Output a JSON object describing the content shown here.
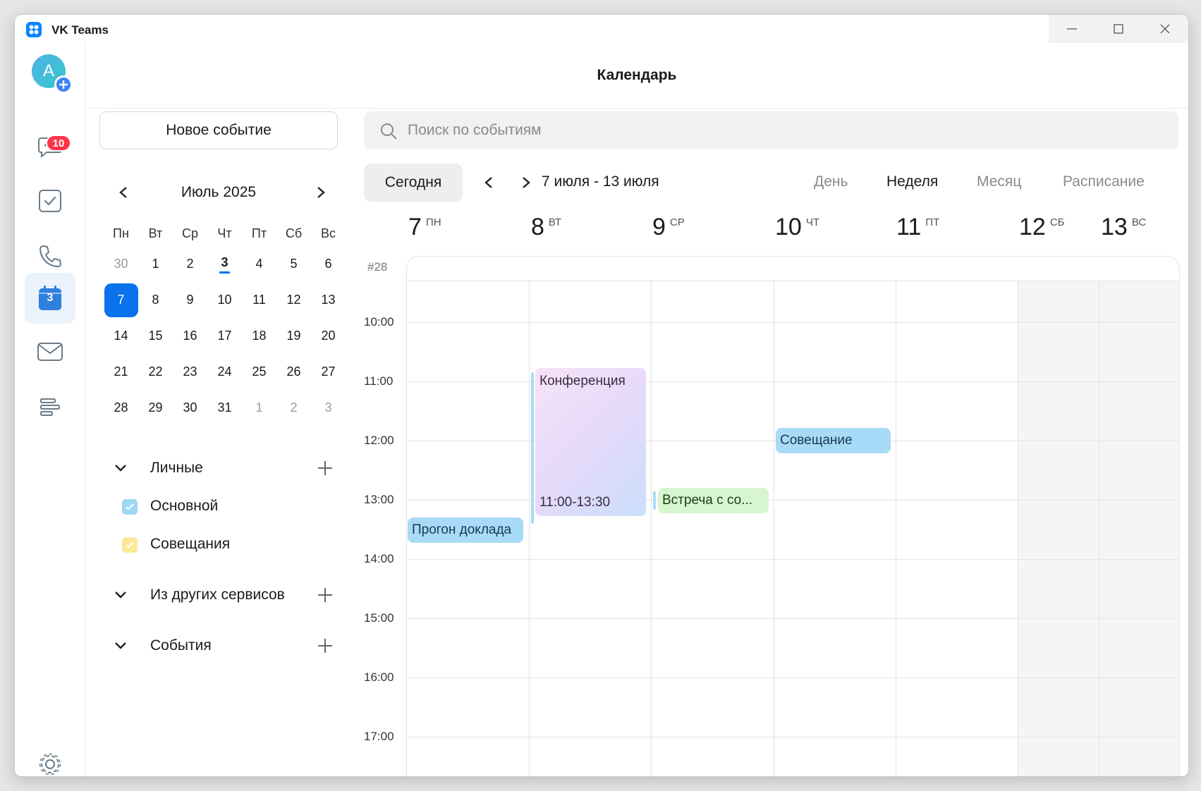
{
  "window": {
    "title": "VK Teams"
  },
  "rail": {
    "avatar_letter": "A",
    "chats_badge": "10",
    "calendar_day": "3"
  },
  "header": {
    "title": "Календарь"
  },
  "sidebar": {
    "new_event_label": "Новое событие",
    "mini_calendar": {
      "month_label": "Июль 2025",
      "weekdays": [
        "Пн",
        "Вт",
        "Ср",
        "Чт",
        "Пт",
        "Сб",
        "Вс"
      ],
      "weeks": [
        [
          "30",
          "1",
          "2",
          "3",
          "4",
          "5",
          "6"
        ],
        [
          "7",
          "8",
          "9",
          "10",
          "11",
          "12",
          "13"
        ],
        [
          "14",
          "15",
          "16",
          "17",
          "18",
          "19",
          "20"
        ],
        [
          "21",
          "22",
          "23",
          "24",
          "25",
          "26",
          "27"
        ],
        [
          "28",
          "29",
          "30",
          "31",
          "1",
          "2",
          "3"
        ]
      ]
    },
    "sections": {
      "personal": "Личные",
      "other_services": "Из других сервисов",
      "events": "События"
    },
    "calendars": [
      {
        "label": "Основной",
        "color": "#9fd6f5"
      },
      {
        "label": "Совещания",
        "color": "#fde99a"
      }
    ]
  },
  "search": {
    "placeholder": "Поиск по событиям"
  },
  "toolbar": {
    "today_label": "Сегодня",
    "range_label": "7 июля - 13 июля",
    "views": [
      "День",
      "Неделя",
      "Месяц",
      "Расписание"
    ],
    "active_view": "Неделя"
  },
  "week": {
    "number_label": "#28",
    "days": [
      {
        "num": "7",
        "wd": "ПН"
      },
      {
        "num": "8",
        "wd": "ВТ"
      },
      {
        "num": "9",
        "wd": "СР"
      },
      {
        "num": "10",
        "wd": "ЧТ"
      },
      {
        "num": "11",
        "wd": "ПТ"
      },
      {
        "num": "12",
        "wd": "СБ"
      },
      {
        "num": "13",
        "wd": "ВС"
      }
    ],
    "hours": [
      "10:00",
      "11:00",
      "12:00",
      "13:00",
      "14:00",
      "15:00",
      "16:00",
      "17:00"
    ]
  },
  "events": {
    "conference": {
      "title": "Конференция",
      "time": "11:00-13:30"
    },
    "meeting": {
      "title": "Совещание"
    },
    "meeting_with": {
      "title": "Встреча с со..."
    },
    "rehearsal": {
      "title": "Прогон доклада"
    }
  },
  "colors": {
    "accent": "#0a72ea",
    "badge": "#ff3347",
    "event_blue": "#a8dbf7",
    "event_green": "#d7f5cf"
  }
}
